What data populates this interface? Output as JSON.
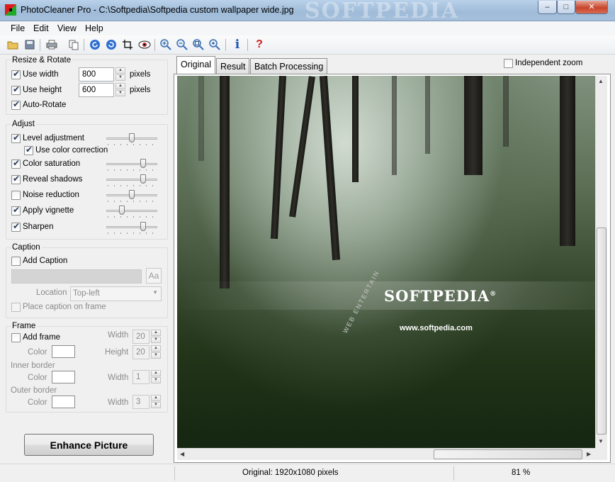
{
  "window": {
    "title": "PhotoCleaner Pro - C:\\Softpedia\\Softpedia custom wallpaper wide.jpg",
    "watermark": "SOFTPEDIA",
    "minimize": "–",
    "maximize": "□",
    "close": "✕"
  },
  "menu": [
    "File",
    "Edit",
    "View",
    "Help"
  ],
  "toolbar": {
    "icons": [
      "open-folder-icon",
      "save-icon",
      "print-icon",
      "copy-icon",
      "rotate-left-icon",
      "rotate-right-icon",
      "crop-icon",
      "preview-eye-icon",
      "zoom-in-icon",
      "zoom-out-icon",
      "zoom-fit-icon",
      "zoom-actual-icon",
      "info-icon",
      "help-icon"
    ],
    "glyphs": {
      "info": "i",
      "help": "?"
    }
  },
  "resize": {
    "title": "Resize & Rotate",
    "use_width": {
      "label": "Use width",
      "checked": true,
      "value": "800",
      "unit": "pixels"
    },
    "use_height": {
      "label": "Use height",
      "checked": true,
      "value": "600",
      "unit": "pixels"
    },
    "auto_rotate": {
      "label": "Auto-Rotate",
      "checked": true
    }
  },
  "adjust": {
    "title": "Adjust",
    "items": [
      {
        "label": "Level adjustment",
        "checked": true,
        "level": 0.5
      },
      {
        "label": "Use color correction",
        "checked": true
      },
      {
        "label": "Color saturation",
        "checked": true,
        "level": 0.75
      },
      {
        "label": "Reveal shadows",
        "checked": true,
        "level": 0.75
      },
      {
        "label": "Noise reduction",
        "checked": false,
        "level": 0.5
      },
      {
        "label": "Apply vignette",
        "checked": true,
        "level": 0.28
      },
      {
        "label": "Sharpen",
        "checked": true,
        "level": 0.75
      }
    ]
  },
  "caption": {
    "title": "Caption",
    "add_caption": {
      "label": "Add Caption",
      "checked": false
    },
    "font_button": "Aa",
    "location_label": "Location",
    "location_value": "Top-left",
    "place_on_frame": {
      "label": "Place caption on frame",
      "checked": false
    }
  },
  "frame": {
    "title": "Frame",
    "add_frame": {
      "label": "Add frame",
      "checked": false
    },
    "width_label": "Width",
    "width_value": "20",
    "height_label": "Height",
    "height_value": "20",
    "color_label": "Color",
    "inner_border_label": "Inner border",
    "inner_width_value": "1",
    "outer_border_label": "Outer border",
    "outer_width_value": "3"
  },
  "enhance_button": "Enhance Picture",
  "tabs": [
    "Original",
    "Result",
    "Batch Processing"
  ],
  "independent_zoom": {
    "label": "Independent zoom",
    "checked": false
  },
  "image": {
    "logo_text": "SOFTPEDIA",
    "logo_mark": "®",
    "url_text": "www.softpedia.com",
    "arc_text": "WEB ENTERTAIN"
  },
  "status": {
    "info": "Original: 1920x1080 pixels",
    "zoom": "81 %"
  }
}
